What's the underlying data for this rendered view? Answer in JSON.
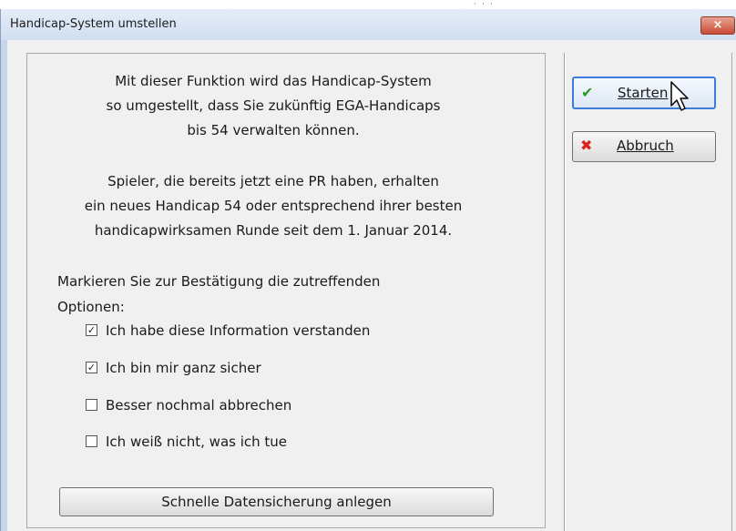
{
  "window": {
    "title": "Handicap-System umstellen",
    "close_symbol": "×"
  },
  "info": {
    "paragraph1": [
      "Mit dieser Funktion wird das Handicap-System",
      "so umgestellt, dass Sie zukünftig EGA-Handicaps",
      "bis 54 verwalten können."
    ],
    "paragraph2": [
      "Spieler, die bereits jetzt eine PR haben, erhalten",
      "ein neues Handicap 54 oder entsprechend ihrer besten",
      "handicapwirksamen Runde seit dem 1. Januar 2014."
    ]
  },
  "prompt": {
    "line1": "Markieren Sie zur Bestätigung die zutreffenden",
    "line2": "Optionen:"
  },
  "options": [
    {
      "label": "Ich habe diese Information verstanden",
      "checked": true
    },
    {
      "label": "Ich bin mir ganz sicher",
      "checked": true
    },
    {
      "label": "Besser nochmal abbrechen",
      "checked": false
    },
    {
      "label": "Ich weiß nicht, was ich tue",
      "checked": false
    }
  ],
  "buttons": {
    "backup_label": "Schnelle Datensicherung anlegen",
    "start_label": "Starten",
    "cancel_label": "Abbruch"
  },
  "icons": {
    "start": "check-icon",
    "cancel": "x-icon",
    "check_symbol": "✔",
    "x_symbol": "✖",
    "checkbox_mark": "✓"
  }
}
